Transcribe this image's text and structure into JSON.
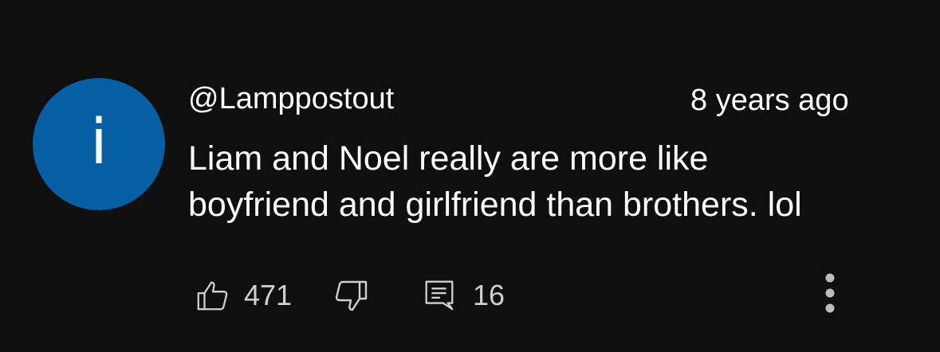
{
  "comment": {
    "avatar_letter": "i",
    "avatar_color": "#065fa3",
    "handle": "@Lamppostout",
    "timestamp": "8 years ago",
    "text_lines": [
      "Liam and Noel really are more like",
      "boyfriend and girlfriend than brothers. lol"
    ]
  },
  "actions": {
    "like_icon": "thumbs-up-icon",
    "like_count": "471",
    "dislike_icon": "thumbs-down-icon",
    "reply_icon": "comment-icon",
    "reply_count": "16",
    "more_icon": "vertical-ellipsis-icon"
  },
  "colors": {
    "background": "#0f0f0f",
    "text": "#ffffff",
    "secondary_text": "#cfcfcf"
  }
}
